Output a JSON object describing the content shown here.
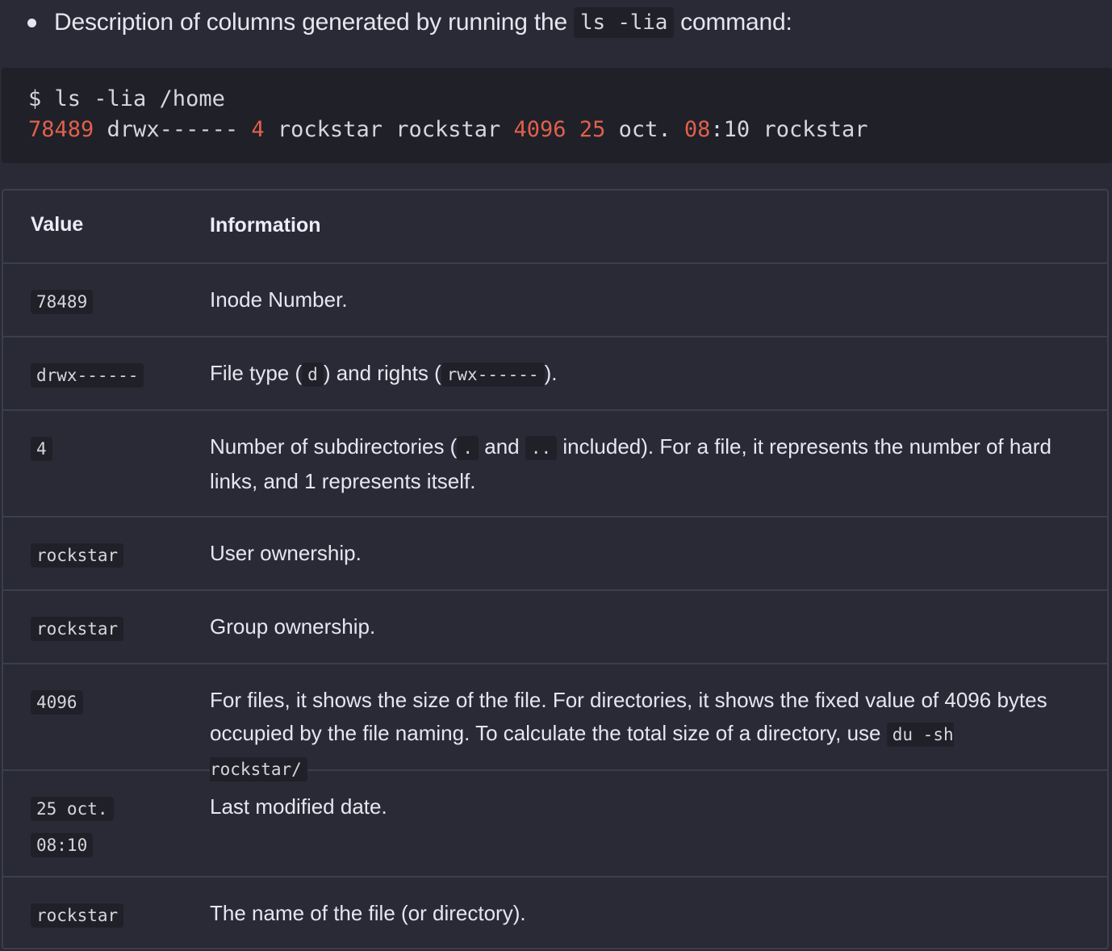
{
  "intro": {
    "text_before": "Description of columns generated by running the",
    "command": "ls -lia",
    "text_after": "command:"
  },
  "codeblock": {
    "prompt_line": "$ ls -lia /home",
    "output": {
      "inode": "78489",
      "perms": "drwx------",
      "links": "4",
      "user": "rockstar",
      "group": "rockstar",
      "size": "4096",
      "day": "25",
      "month": "oct.",
      "hour": "08",
      "minute_sep": ":10",
      "name": "rockstar"
    },
    "highlight_color": "#e0604c"
  },
  "table": {
    "headers": {
      "value": "Value",
      "information": "Information"
    },
    "rows": [
      {
        "value": "78489",
        "info": "Inode Number."
      },
      {
        "value": "drwx------",
        "info_parts": [
          "File type (",
          "d",
          ") and rights (",
          "rwx------",
          ")."
        ]
      },
      {
        "value": "4",
        "info_parts": [
          "Number of subdirectories (",
          ".",
          "and",
          "..",
          "included). For a file, it represents the number of hard links, and 1 represents itself."
        ]
      },
      {
        "value": "rockstar",
        "info": "User ownership."
      },
      {
        "value": "rockstar",
        "info": "Group ownership."
      },
      {
        "value": "4096",
        "info_parts": [
          "For files, it shows the size of the file. For directories, it shows the fixed value of 4096 bytes occupied by the file naming. To calculate the total size of a directory, use",
          "du -sh rockstar/"
        ]
      },
      {
        "value_lines": [
          "25 oct.",
          "08:10"
        ],
        "info": "Last modified date."
      },
      {
        "value": "rockstar",
        "info": "The name of the file (or directory)."
      }
    ]
  }
}
